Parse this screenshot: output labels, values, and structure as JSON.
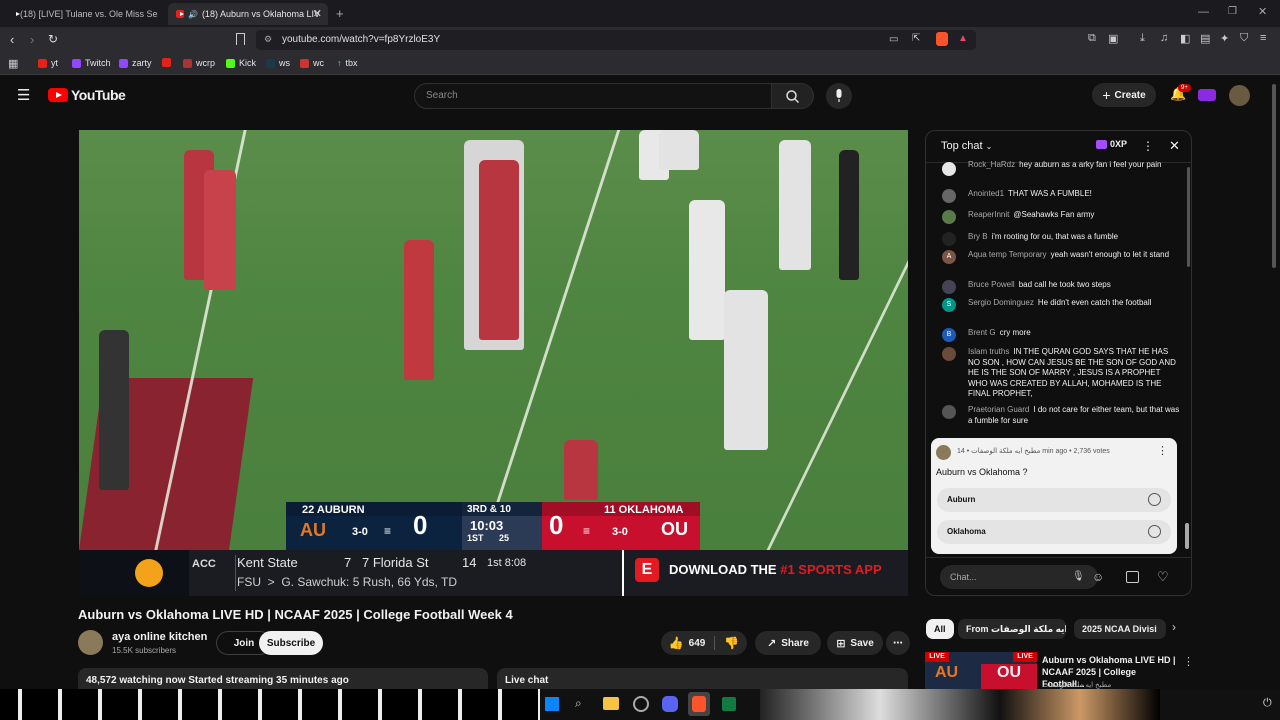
{
  "browser": {
    "tabs": [
      {
        "label": "(18) [LIVE] Tulane vs. Ole Miss Se",
        "active": false
      },
      {
        "label": "(18) Auburn vs Oklahoma LIV",
        "active": true
      }
    ],
    "url": "youtube.com/watch?v=fp8YrzloE3Y",
    "bookmarks": [
      "yt",
      "Twitch",
      "zarty",
      "wcrp",
      "Kick",
      "ws",
      "wc",
      "tbx"
    ]
  },
  "youtube": {
    "logo": "YouTube",
    "search_placeholder": "Search",
    "create_label": "Create",
    "notif_badge": "9+"
  },
  "video": {
    "scoreboard": {
      "away_rank_name": "22 AUBURN",
      "away_record": "3-0",
      "away_score": "0",
      "down_distance": "3RD & 10",
      "clock": "10:03",
      "quarter": "1ST",
      "play_clock": "25",
      "home_rank_name": "11 OKLAHOMA",
      "home_score": "0",
      "home_record": "3-0"
    },
    "ticker": {
      "conf": "ACC",
      "team1": "Kent State",
      "score1": "7",
      "team2": "7 Florida St",
      "score2": "14",
      "period": "1st 8:08",
      "line2": "FSU  >  G. Sawchuk: 5 Rush, 66 Yds, TD",
      "ad": "DOWNLOAD THE",
      "ad_highlight": "#1 SPORTS APP"
    }
  },
  "title": "Auburn vs Oklahoma LIVE HD | NCAAF 2025 | College Football Week 4",
  "channel": {
    "name": "aya online kitchen",
    "subs": "15.5K subscribers",
    "join": "Join",
    "subscribe": "Subscribe",
    "likes": "649",
    "share": "Share",
    "save": "Save"
  },
  "info": {
    "watching": "48,572 watching now  Started streaming 35 minutes ago",
    "live_chat": "Live chat"
  },
  "chat": {
    "header": "Top chat",
    "xp": "0XP",
    "messages": [
      {
        "author": "Rock_HaRdz",
        "text": "hey auburn as a arky fan i feel your pain",
        "color": "#e6e6e6",
        "init": ""
      },
      {
        "author": "Anointed1",
        "text": "THAT WAS A FUMBLE!",
        "color": "#666",
        "init": ""
      },
      {
        "author": "ReaperInnit",
        "text": "@Seahawks Fan army",
        "color": "#5a7a4a",
        "init": ""
      },
      {
        "author": "Bry B",
        "text": "i'm rooting for ou, that was a fumble",
        "color": "#222",
        "init": ""
      },
      {
        "author": "Aqua temp Temporary",
        "text": "yeah wasn't enough to let it stand",
        "color": "#7a5548",
        "init": "A"
      },
      {
        "author": "Bruce Powell",
        "text": "bad call he took two steps",
        "color": "#445",
        "init": ""
      },
      {
        "author": "Sergio Dominguez",
        "text": "He didn't even catch the football",
        "color": "#009688",
        "init": "S"
      },
      {
        "author": "Brent G",
        "text": "cry more",
        "color": "#1e5bb8",
        "init": "B"
      },
      {
        "author": "Islam truths",
        "text": "IN THE QURAN GOD SAYS THAT HE HAS NO SON , HOW CAN JESUS BE THE SON OF GOD AND HE IS THE SON OF MARRY , JESUS IS A PROPHET WHO WAS CREATED BY ALLAH, MOHAMED IS THE FINAL PROPHET,",
        "color": "#6a4a3a",
        "init": ""
      },
      {
        "author": "Praetorian Guard",
        "text": "I do not care for either team, but that was a fumble for sure",
        "color": "#555",
        "init": ""
      }
    ],
    "poll": {
      "meta": "مطبخ ايه ملكة الوصفات • 14 min ago • 2,736 votes",
      "question": "Auburn vs Oklahoma ?",
      "options": [
        "Auburn",
        "Oklahoma"
      ]
    },
    "input_placeholder": "Chat..."
  },
  "chips": [
    "All",
    "From مطبخ ايه ملكة الوصفات",
    "2025 NCAA Divisi"
  ],
  "recommendation": {
    "title": "Auburn vs Oklahoma LIVE HD | NCAAF 2025 | College Football...",
    "badge": "LIVE",
    "channel": "مطبخ ايه ملكة الوصفات"
  }
}
